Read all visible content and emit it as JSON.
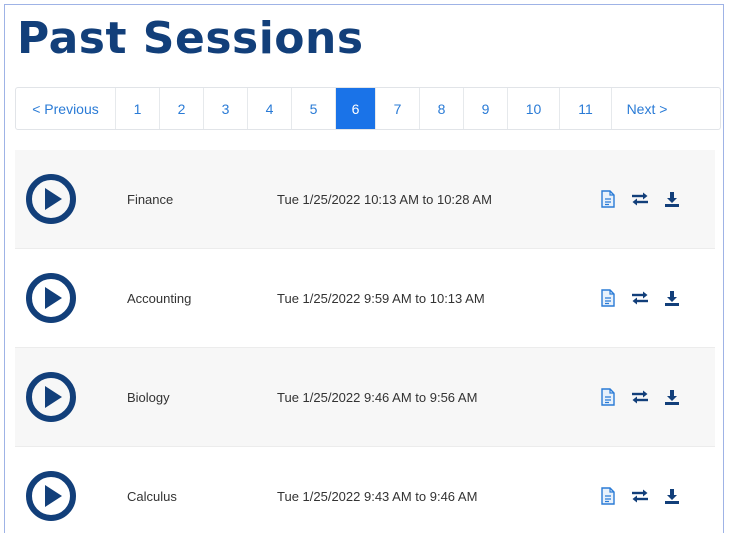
{
  "page": {
    "title": "Past Sessions"
  },
  "pagination": {
    "prev_label": "< Previous",
    "pages": [
      "1",
      "2",
      "3",
      "4",
      "5",
      "6",
      "7",
      "8",
      "9",
      "10",
      "11"
    ],
    "active_page": "6",
    "next_label": "Next >"
  },
  "sessions": [
    {
      "name": "Finance",
      "time": "Tue 1/25/2022 10:13 AM to 10:28 AM"
    },
    {
      "name": "Accounting",
      "time": "Tue 1/25/2022 9:59 AM to 10:13 AM"
    },
    {
      "name": "Biology",
      "time": "Tue 1/25/2022 9:46 AM to 9:56 AM"
    },
    {
      "name": "Calculus",
      "time": "Tue 1/25/2022 9:43 AM to 9:46 AM"
    }
  ],
  "icons": {
    "play": "play-circle-icon",
    "transcript": "document-icon",
    "swap": "swap-arrows-icon",
    "download": "download-icon"
  },
  "colors": {
    "brand": "#123f7a",
    "accent": "#1a73e8",
    "link": "#2a7bd6"
  }
}
